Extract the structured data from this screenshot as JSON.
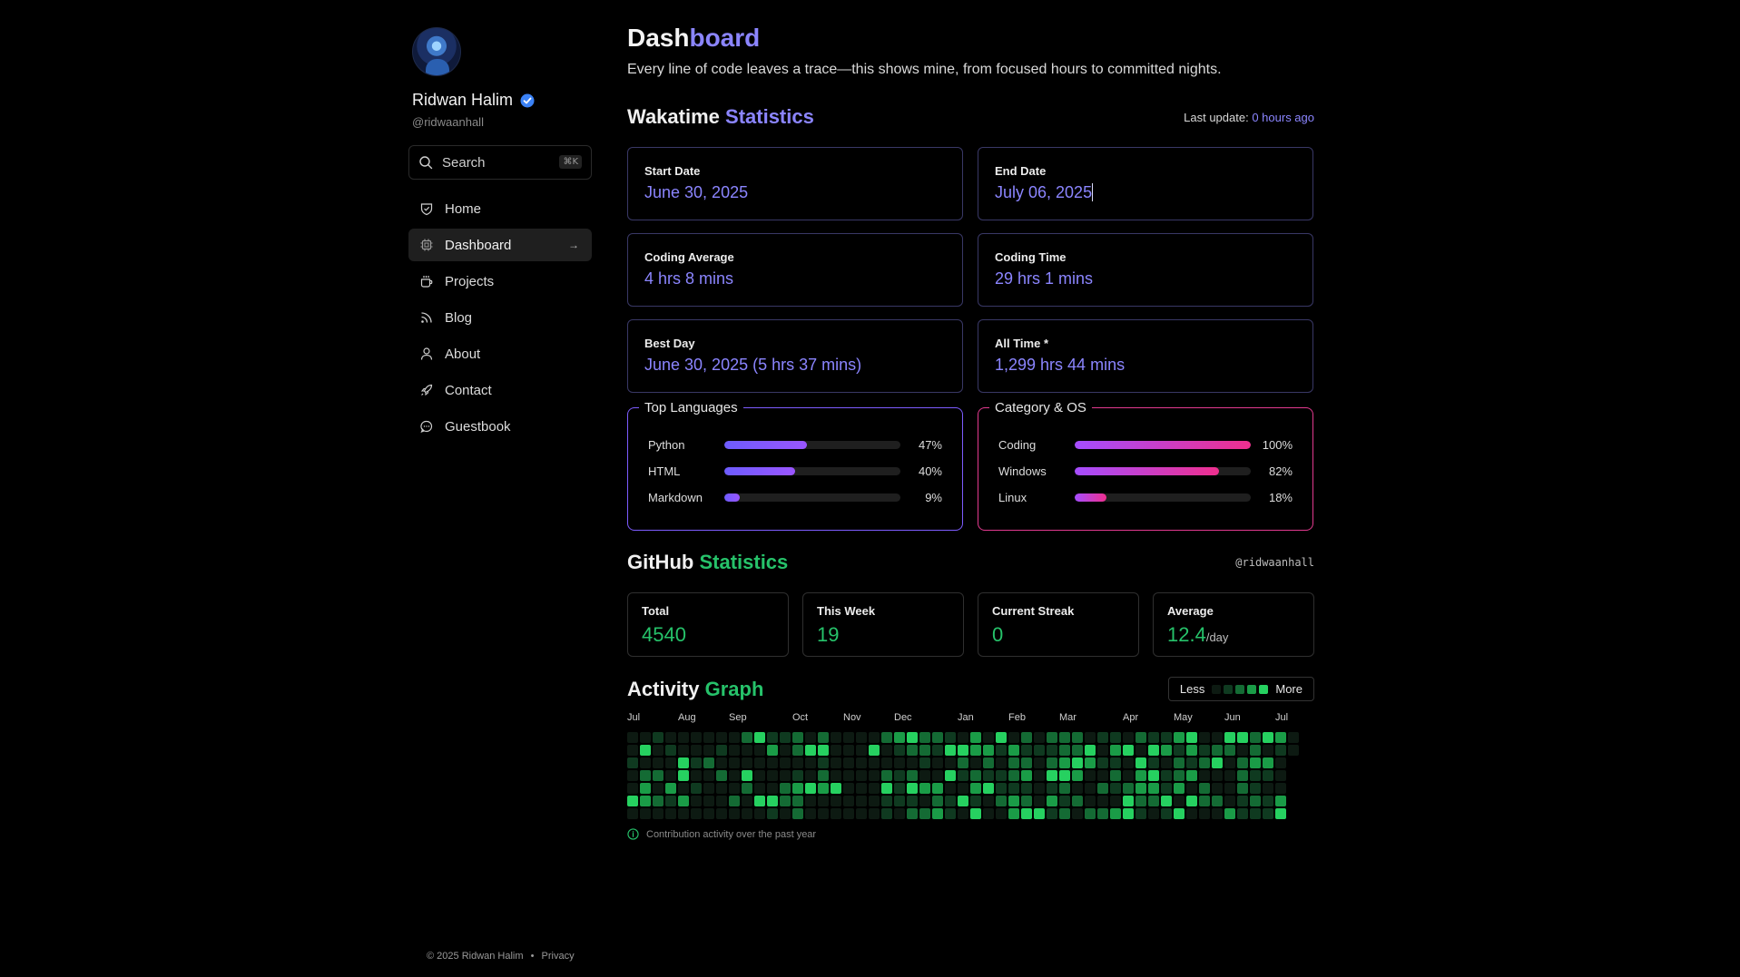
{
  "profile": {
    "name": "Ridwan Halim",
    "handle": "@ridwaanhall"
  },
  "search": {
    "label": "Search",
    "shortcut": "⌘K"
  },
  "nav": [
    {
      "label": "Home",
      "icon": "home-icon"
    },
    {
      "label": "Dashboard",
      "icon": "chip-icon",
      "active": true
    },
    {
      "label": "Projects",
      "icon": "coffee-icon"
    },
    {
      "label": "Blog",
      "icon": "rss-icon"
    },
    {
      "label": "About",
      "icon": "user-icon"
    },
    {
      "label": "Contact",
      "icon": "rocket-icon"
    },
    {
      "label": "Guestbook",
      "icon": "chat-icon"
    }
  ],
  "footer": {
    "copyright": "© 2025 Ridwan Halim",
    "separator": "•",
    "privacy": "Privacy"
  },
  "header": {
    "title_a": "Dash",
    "title_b": "board",
    "subtitle": "Every line of code leaves a trace—this shows mine, from focused hours to committed nights."
  },
  "wakatime": {
    "title_a": "Wakatime",
    "title_b": "Statistics",
    "last_update_label": "Last update:",
    "last_update_value": "0 hours ago",
    "cards": [
      {
        "label": "Start Date",
        "value": "June 30, 2025"
      },
      {
        "label": "End Date",
        "value": "July 06, 2025"
      },
      {
        "label": "Coding Average",
        "value": "4 hrs 8 mins"
      },
      {
        "label": "Coding Time",
        "value": "29 hrs 1 mins"
      },
      {
        "label": "Best Day",
        "value": "June 30, 2025 (5 hrs 37 mins)"
      },
      {
        "label": "All Time *",
        "value": "1,299 hrs 44 mins"
      }
    ],
    "languages": {
      "title": "Top Languages",
      "items": [
        {
          "name": "Python",
          "percent": 47,
          "label": "47%"
        },
        {
          "name": "HTML",
          "percent": 40,
          "label": "40%"
        },
        {
          "name": "Markdown",
          "percent": 9,
          "label": "9%"
        }
      ]
    },
    "categories": {
      "title": "Category & OS",
      "items": [
        {
          "name": "Coding",
          "percent": 100,
          "label": "100%"
        },
        {
          "name": "Windows",
          "percent": 82,
          "label": "82%"
        },
        {
          "name": "Linux",
          "percent": 18,
          "label": "18%"
        }
      ]
    },
    "colors": {
      "accent": "#8b85ff",
      "card_border": "#393866",
      "lang_border": "#7d5cff",
      "cat_border": "#e23a8f"
    }
  },
  "github": {
    "title_a": "GitHub",
    "title_b": "Statistics",
    "handle": "@ridwaanhall",
    "cards": [
      {
        "label": "Total",
        "value": "4540",
        "unit": ""
      },
      {
        "label": "This Week",
        "value": "19",
        "unit": ""
      },
      {
        "label": "Current Streak",
        "value": "0",
        "unit": ""
      },
      {
        "label": "Average",
        "value": "12.4",
        "unit": "/day"
      }
    ],
    "accent": "#26c26a"
  },
  "activity": {
    "title_a": "Activity",
    "title_b": "Graph",
    "legend_less": "Less",
    "legend_more": "More",
    "months": [
      "Jul",
      "Aug",
      "Sep",
      "Oct",
      "Nov",
      "Dec",
      "Jan",
      "Feb",
      "Mar",
      "Apr",
      "May",
      "Jun",
      "Jul"
    ],
    "month_start_week": [
      0,
      4,
      8,
      13,
      17,
      21,
      26,
      30,
      34,
      39,
      43,
      47,
      51
    ],
    "levels": [
      "#0d1a12",
      "#0f3a20",
      "#146b34",
      "#1a9c47",
      "#26d160"
    ],
    "note": "Contribution activity over the past year"
  }
}
